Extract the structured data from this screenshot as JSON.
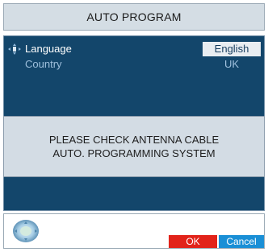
{
  "title": "AUTO PROGRAM",
  "settings": {
    "language": {
      "label": "Language",
      "value": "English"
    },
    "country": {
      "label": "Country",
      "value": "UK"
    }
  },
  "message": {
    "line1": "PLEASE CHECK ANTENNA CABLE",
    "line2": "AUTO. PROGRAMMING SYSTEM"
  },
  "buttons": {
    "ok": "OK",
    "cancel": "Cancel"
  },
  "icons": {
    "selection_cursor": "arrow-cross-icon",
    "navigation": "nav-pad-icon"
  },
  "colors": {
    "panel": "#13466b",
    "title_bar": "#d4dde4",
    "message_box": "#d3dce4",
    "ok_button": "#e2231a",
    "cancel_button": "#1a8fd6",
    "selected_value_bg": "#e9edf1",
    "inactive_text": "#9fc0dd"
  }
}
